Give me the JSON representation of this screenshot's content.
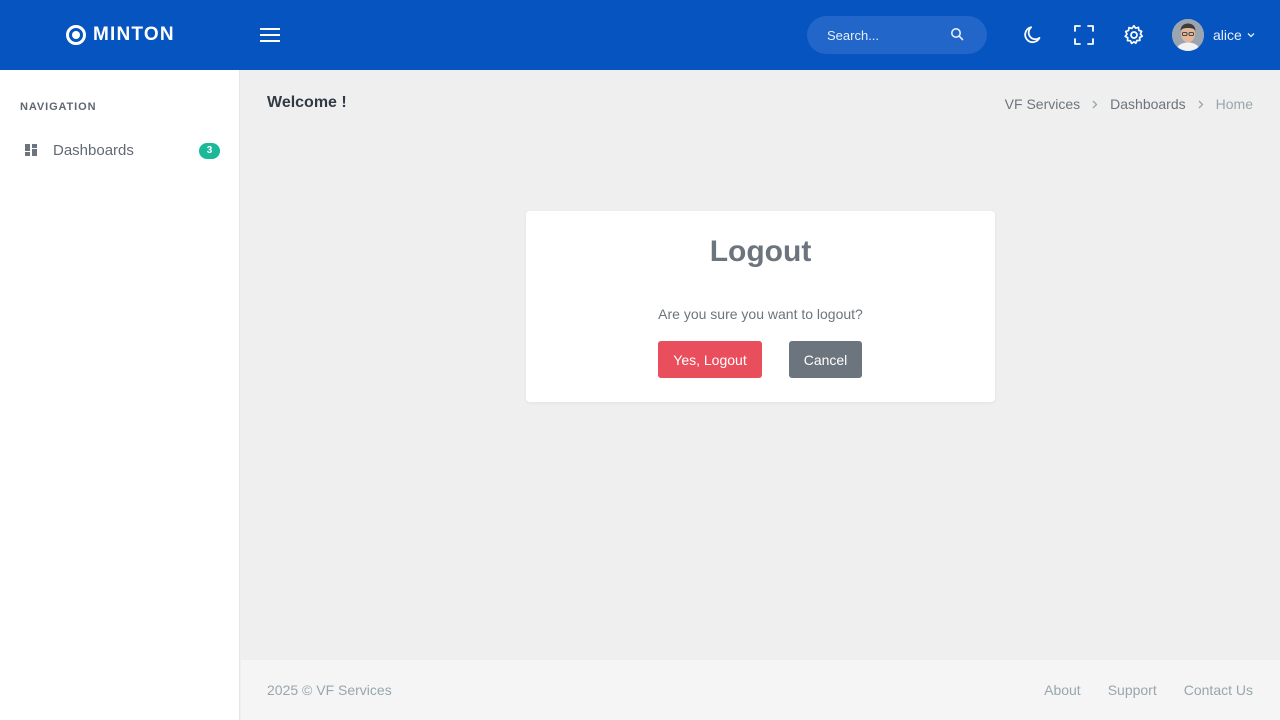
{
  "header": {
    "brand": "MINTON",
    "search_placeholder": "Search...",
    "icons": [
      "menu-icon",
      "search-icon",
      "moon-icon",
      "fullscreen-icon",
      "gear-icon",
      "chevron-down-icon"
    ],
    "user_name": "alice",
    "color_bg": "#0554bf"
  },
  "sidebar": {
    "section_title": "NAVIGATION",
    "items": [
      {
        "label": "Dashboards",
        "badge": "3",
        "icon": "dashboard-icon"
      }
    ]
  },
  "page": {
    "title": "Welcome !",
    "breadcrumb": [
      "VF Services",
      "Dashboards",
      "Home"
    ]
  },
  "dialog": {
    "title": "Logout",
    "message": "Are you sure you want to logout?",
    "confirm_label": "Yes, Logout",
    "cancel_label": "Cancel",
    "confirm_color": "#e94e5d",
    "cancel_color": "#6c757d"
  },
  "footer": {
    "copyright": "2025 © VF Services",
    "links": [
      "About",
      "Support",
      "Contact Us"
    ]
  }
}
